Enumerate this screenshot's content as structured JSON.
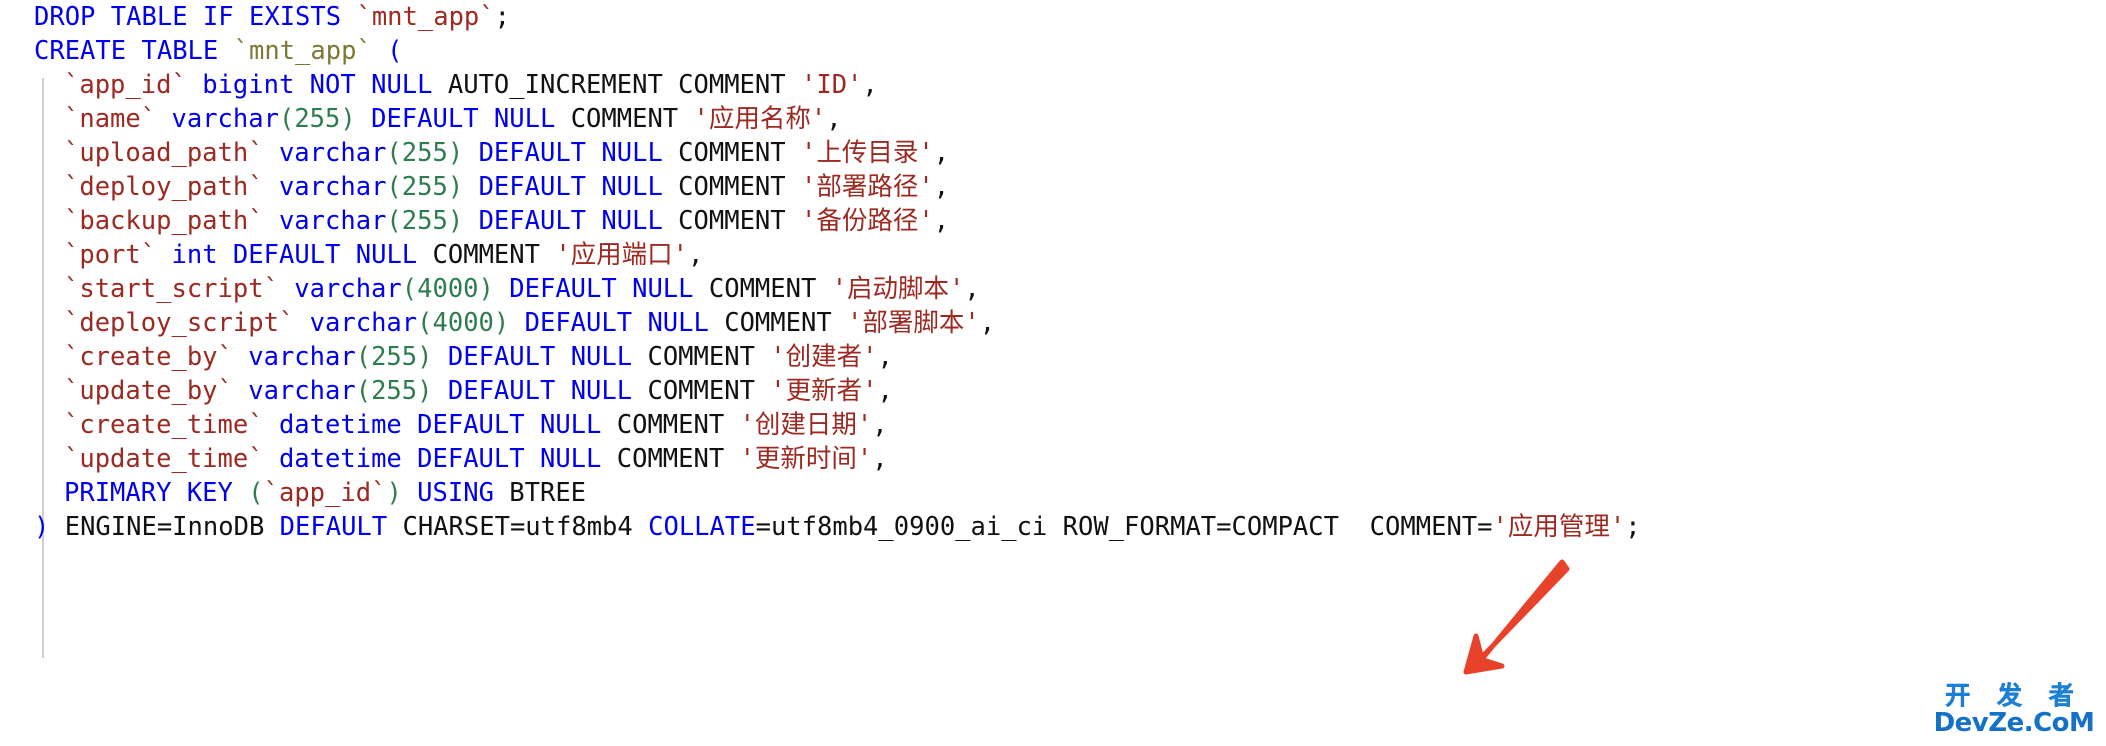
{
  "editor": {
    "language": "sql",
    "background_color": "#ffffff",
    "indent_guide_color": "#cfcfcf",
    "colors": {
      "keyword": "#0000ee",
      "identifier": "#9c2a22",
      "string": "#9c2a22",
      "number": "#2e7d4f",
      "plain": "#111111",
      "table_name": "#7d7832",
      "arrow": "#e8432a",
      "watermark": "#1372c8"
    }
  },
  "code": {
    "lines": [
      {
        "id": "line-1-drop-table",
        "indent": false,
        "tokens": [
          {
            "t": "DROP",
            "c": "kw"
          },
          {
            "t": " ",
            "c": "plain"
          },
          {
            "t": "TABLE",
            "c": "kw"
          },
          {
            "t": " ",
            "c": "plain"
          },
          {
            "t": "IF",
            "c": "kw"
          },
          {
            "t": " ",
            "c": "plain"
          },
          {
            "t": "EXISTS",
            "c": "kw"
          },
          {
            "t": " ",
            "c": "plain"
          },
          {
            "t": "`mnt_app`",
            "c": "ident"
          },
          {
            "t": ";",
            "c": "punc"
          }
        ]
      },
      {
        "id": "line-2-create-table",
        "indent": false,
        "tokens": [
          {
            "t": "CREATE",
            "c": "kw"
          },
          {
            "t": " ",
            "c": "plain"
          },
          {
            "t": "TABLE",
            "c": "kw"
          },
          {
            "t": " ",
            "c": "plain"
          },
          {
            "t": "`mnt_app`",
            "c": "tblname"
          },
          {
            "t": " ",
            "c": "plain"
          },
          {
            "t": "(",
            "c": "kw"
          }
        ]
      },
      {
        "id": "line-3-col-app-id",
        "indent": true,
        "tokens": [
          {
            "t": "`app_id`",
            "c": "ident"
          },
          {
            "t": " ",
            "c": "plain"
          },
          {
            "t": "bigint",
            "c": "kw"
          },
          {
            "t": " ",
            "c": "plain"
          },
          {
            "t": "NOT",
            "c": "kw"
          },
          {
            "t": " ",
            "c": "plain"
          },
          {
            "t": "NULL",
            "c": "kw"
          },
          {
            "t": " AUTO_INCREMENT COMMENT ",
            "c": "plain"
          },
          {
            "t": "'ID'",
            "c": "str"
          },
          {
            "t": ",",
            "c": "punc"
          }
        ]
      },
      {
        "id": "line-4-col-name",
        "indent": true,
        "tokens": [
          {
            "t": "`name`",
            "c": "ident"
          },
          {
            "t": " ",
            "c": "plain"
          },
          {
            "t": "varchar",
            "c": "kw"
          },
          {
            "t": "(",
            "c": "paren"
          },
          {
            "t": "255",
            "c": "num"
          },
          {
            "t": ")",
            "c": "paren"
          },
          {
            "t": " ",
            "c": "plain"
          },
          {
            "t": "DEFAULT",
            "c": "kw"
          },
          {
            "t": " ",
            "c": "plain"
          },
          {
            "t": "NULL",
            "c": "kw"
          },
          {
            "t": " COMMENT ",
            "c": "plain"
          },
          {
            "t": "'应用名称'",
            "c": "str"
          },
          {
            "t": ",",
            "c": "punc"
          }
        ]
      },
      {
        "id": "line-5-col-upload-path",
        "indent": true,
        "tokens": [
          {
            "t": "`upload_path`",
            "c": "ident"
          },
          {
            "t": " ",
            "c": "plain"
          },
          {
            "t": "varchar",
            "c": "kw"
          },
          {
            "t": "(",
            "c": "paren"
          },
          {
            "t": "255",
            "c": "num"
          },
          {
            "t": ")",
            "c": "paren"
          },
          {
            "t": " ",
            "c": "plain"
          },
          {
            "t": "DEFAULT",
            "c": "kw"
          },
          {
            "t": " ",
            "c": "plain"
          },
          {
            "t": "NULL",
            "c": "kw"
          },
          {
            "t": " COMMENT ",
            "c": "plain"
          },
          {
            "t": "'上传目录'",
            "c": "str"
          },
          {
            "t": ",",
            "c": "punc"
          }
        ]
      },
      {
        "id": "line-6-col-deploy-path",
        "indent": true,
        "tokens": [
          {
            "t": "`deploy_path`",
            "c": "ident"
          },
          {
            "t": " ",
            "c": "plain"
          },
          {
            "t": "varchar",
            "c": "kw"
          },
          {
            "t": "(",
            "c": "paren"
          },
          {
            "t": "255",
            "c": "num"
          },
          {
            "t": ")",
            "c": "paren"
          },
          {
            "t": " ",
            "c": "plain"
          },
          {
            "t": "DEFAULT",
            "c": "kw"
          },
          {
            "t": " ",
            "c": "plain"
          },
          {
            "t": "NULL",
            "c": "kw"
          },
          {
            "t": " COMMENT ",
            "c": "plain"
          },
          {
            "t": "'部署路径'",
            "c": "str"
          },
          {
            "t": ",",
            "c": "punc"
          }
        ]
      },
      {
        "id": "line-7-col-backup-path",
        "indent": true,
        "tokens": [
          {
            "t": "`backup_path`",
            "c": "ident"
          },
          {
            "t": " ",
            "c": "plain"
          },
          {
            "t": "varchar",
            "c": "kw"
          },
          {
            "t": "(",
            "c": "paren"
          },
          {
            "t": "255",
            "c": "num"
          },
          {
            "t": ")",
            "c": "paren"
          },
          {
            "t": " ",
            "c": "plain"
          },
          {
            "t": "DEFAULT",
            "c": "kw"
          },
          {
            "t": " ",
            "c": "plain"
          },
          {
            "t": "NULL",
            "c": "kw"
          },
          {
            "t": " COMMENT ",
            "c": "plain"
          },
          {
            "t": "'备份路径'",
            "c": "str"
          },
          {
            "t": ",",
            "c": "punc"
          }
        ]
      },
      {
        "id": "line-8-col-port",
        "indent": true,
        "tokens": [
          {
            "t": "`port`",
            "c": "ident"
          },
          {
            "t": " ",
            "c": "plain"
          },
          {
            "t": "int",
            "c": "kw"
          },
          {
            "t": " ",
            "c": "plain"
          },
          {
            "t": "DEFAULT",
            "c": "kw"
          },
          {
            "t": " ",
            "c": "plain"
          },
          {
            "t": "NULL",
            "c": "kw"
          },
          {
            "t": " COMMENT ",
            "c": "plain"
          },
          {
            "t": "'应用端口'",
            "c": "str"
          },
          {
            "t": ",",
            "c": "punc"
          }
        ]
      },
      {
        "id": "line-9-col-start-script",
        "indent": true,
        "tokens": [
          {
            "t": "`start_script`",
            "c": "ident"
          },
          {
            "t": " ",
            "c": "plain"
          },
          {
            "t": "varchar",
            "c": "kw"
          },
          {
            "t": "(",
            "c": "paren"
          },
          {
            "t": "4000",
            "c": "num"
          },
          {
            "t": ")",
            "c": "paren"
          },
          {
            "t": " ",
            "c": "plain"
          },
          {
            "t": "DEFAULT",
            "c": "kw"
          },
          {
            "t": " ",
            "c": "plain"
          },
          {
            "t": "NULL",
            "c": "kw"
          },
          {
            "t": " COMMENT ",
            "c": "plain"
          },
          {
            "t": "'启动脚本'",
            "c": "str"
          },
          {
            "t": ",",
            "c": "punc"
          }
        ]
      },
      {
        "id": "line-10-col-deploy-script",
        "indent": true,
        "tokens": [
          {
            "t": "`deploy_script`",
            "c": "ident"
          },
          {
            "t": " ",
            "c": "plain"
          },
          {
            "t": "varchar",
            "c": "kw"
          },
          {
            "t": "(",
            "c": "paren"
          },
          {
            "t": "4000",
            "c": "num"
          },
          {
            "t": ")",
            "c": "paren"
          },
          {
            "t": " ",
            "c": "plain"
          },
          {
            "t": "DEFAULT",
            "c": "kw"
          },
          {
            "t": " ",
            "c": "plain"
          },
          {
            "t": "NULL",
            "c": "kw"
          },
          {
            "t": " COMMENT ",
            "c": "plain"
          },
          {
            "t": "'部署脚本'",
            "c": "str"
          },
          {
            "t": ",",
            "c": "punc"
          }
        ]
      },
      {
        "id": "line-11-col-create-by",
        "indent": true,
        "tokens": [
          {
            "t": "`create_by`",
            "c": "ident"
          },
          {
            "t": " ",
            "c": "plain"
          },
          {
            "t": "varchar",
            "c": "kw"
          },
          {
            "t": "(",
            "c": "paren"
          },
          {
            "t": "255",
            "c": "num"
          },
          {
            "t": ")",
            "c": "paren"
          },
          {
            "t": " ",
            "c": "plain"
          },
          {
            "t": "DEFAULT",
            "c": "kw"
          },
          {
            "t": " ",
            "c": "plain"
          },
          {
            "t": "NULL",
            "c": "kw"
          },
          {
            "t": " COMMENT ",
            "c": "plain"
          },
          {
            "t": "'创建者'",
            "c": "str"
          },
          {
            "t": ",",
            "c": "punc"
          }
        ]
      },
      {
        "id": "line-12-col-update-by",
        "indent": true,
        "tokens": [
          {
            "t": "`update_by`",
            "c": "ident"
          },
          {
            "t": " ",
            "c": "plain"
          },
          {
            "t": "varchar",
            "c": "kw"
          },
          {
            "t": "(",
            "c": "paren"
          },
          {
            "t": "255",
            "c": "num"
          },
          {
            "t": ")",
            "c": "paren"
          },
          {
            "t": " ",
            "c": "plain"
          },
          {
            "t": "DEFAULT",
            "c": "kw"
          },
          {
            "t": " ",
            "c": "plain"
          },
          {
            "t": "NULL",
            "c": "kw"
          },
          {
            "t": " COMMENT ",
            "c": "plain"
          },
          {
            "t": "'更新者'",
            "c": "str"
          },
          {
            "t": ",",
            "c": "punc"
          }
        ]
      },
      {
        "id": "line-13-col-create-time",
        "indent": true,
        "tokens": [
          {
            "t": "`create_time`",
            "c": "ident"
          },
          {
            "t": " ",
            "c": "plain"
          },
          {
            "t": "datetime",
            "c": "kw"
          },
          {
            "t": " ",
            "c": "plain"
          },
          {
            "t": "DEFAULT",
            "c": "kw"
          },
          {
            "t": " ",
            "c": "plain"
          },
          {
            "t": "NULL",
            "c": "kw"
          },
          {
            "t": " COMMENT ",
            "c": "plain"
          },
          {
            "t": "'创建日期'",
            "c": "str"
          },
          {
            "t": ",",
            "c": "punc"
          }
        ]
      },
      {
        "id": "line-14-col-update-time",
        "indent": true,
        "tokens": [
          {
            "t": "`update_time`",
            "c": "ident"
          },
          {
            "t": " ",
            "c": "plain"
          },
          {
            "t": "datetime",
            "c": "kw"
          },
          {
            "t": " ",
            "c": "plain"
          },
          {
            "t": "DEFAULT",
            "c": "kw"
          },
          {
            "t": " ",
            "c": "plain"
          },
          {
            "t": "NULL",
            "c": "kw"
          },
          {
            "t": " COMMENT ",
            "c": "plain"
          },
          {
            "t": "'更新时间'",
            "c": "str"
          },
          {
            "t": ",",
            "c": "punc"
          }
        ]
      },
      {
        "id": "line-15-primary-key",
        "indent": true,
        "tokens": [
          {
            "t": "PRIMARY",
            "c": "kw"
          },
          {
            "t": " ",
            "c": "plain"
          },
          {
            "t": "KEY",
            "c": "kw"
          },
          {
            "t": " ",
            "c": "plain"
          },
          {
            "t": "(",
            "c": "paren"
          },
          {
            "t": "`app_id`",
            "c": "ident"
          },
          {
            "t": ")",
            "c": "paren"
          },
          {
            "t": " ",
            "c": "plain"
          },
          {
            "t": "USING",
            "c": "kw"
          },
          {
            "t": " BTREE",
            "c": "plain"
          }
        ]
      },
      {
        "id": "line-16-table-options",
        "indent": false,
        "tokens": [
          {
            "t": ")",
            "c": "kw"
          },
          {
            "t": " ENGINE=InnoDB ",
            "c": "plain"
          },
          {
            "t": "DEFAULT",
            "c": "kw"
          },
          {
            "t": " CHARSET=utf8mb4 ",
            "c": "plain"
          },
          {
            "t": "COLLATE",
            "c": "kw"
          },
          {
            "t": "=utf8mb4_0900_ai_ci ROW_FORMAT=COMPACT  COMMENT=",
            "c": "plain"
          },
          {
            "t": "'应用管理'",
            "c": "str"
          },
          {
            "t": ";",
            "c": "punc"
          }
        ]
      }
    ]
  },
  "annotation": {
    "arrow": {
      "name": "red-annotation-arrow",
      "color": "#e8432a",
      "points_to": "line-16-table-options",
      "direction": "down-left"
    }
  },
  "watermark": {
    "cn_text": "开 发 者",
    "en_text": "DevZe.CoM",
    "color": "#1372c8"
  }
}
